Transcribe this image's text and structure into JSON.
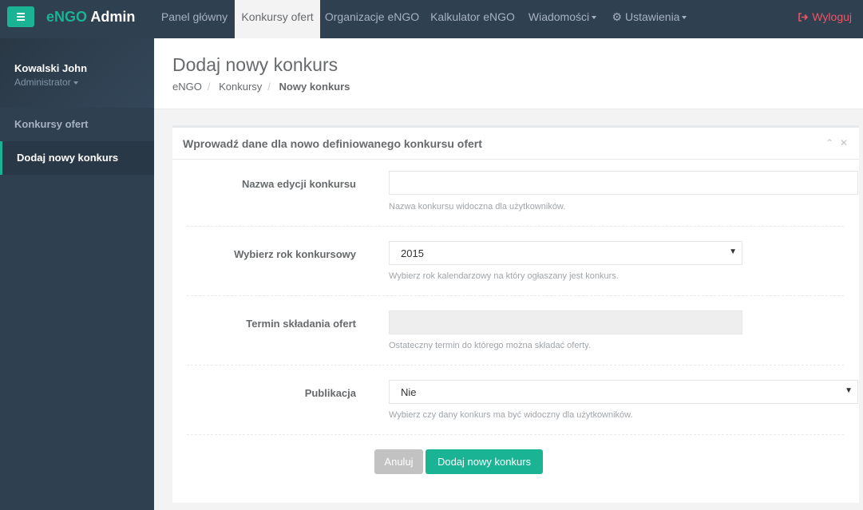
{
  "topnav": {
    "brand_prefix": "eNGO",
    "brand_suffix": " Admin",
    "items": [
      {
        "label": "Panel główny"
      },
      {
        "label": "Konkursy ofert"
      },
      {
        "label": "Organizacje eNGO"
      },
      {
        "label": "Kalkulator eNGO"
      },
      {
        "label": "Wiadomości"
      },
      {
        "label": "Ustawienia"
      }
    ],
    "logout": "Wyloguj"
  },
  "profile": {
    "name": "Kowalski John",
    "role": "Administrator"
  },
  "sidebar": {
    "items": [
      {
        "label": "Konkursy ofert"
      },
      {
        "label": "Dodaj nowy konkurs"
      }
    ]
  },
  "header": {
    "title": "Dodaj nowy konkurs",
    "breadcrumb": [
      "eNGO",
      "Konkursy",
      "Nowy konkurs"
    ]
  },
  "panel": {
    "title": "Wprowadź dane dla nowo definiowanego konkursu ofert",
    "fields": [
      {
        "label": "Nazwa edycji konkursu",
        "value": "",
        "help": "Nazwa konkursu widoczna dla użytkowników."
      },
      {
        "label": "Wybierz rok konkursowy",
        "value": "2015",
        "help": "Wybierz rok kalendarzowy na który ogłaszany jest konkurs."
      },
      {
        "label": "Termin składania ofert",
        "value": "",
        "help": "Ostateczny termin do którego można składać oferty."
      },
      {
        "label": "Publikacja",
        "value": "Nie",
        "help": "Wybierz czy dany konkurs ma być widoczny dla użytkowników."
      }
    ],
    "cancel_label": "Anuluj",
    "submit_label": "Dodaj nowy konkurs"
  },
  "colors": {
    "accent": "#1ab394",
    "nav_bg": "#2f4050",
    "logout": "#ed5565"
  }
}
